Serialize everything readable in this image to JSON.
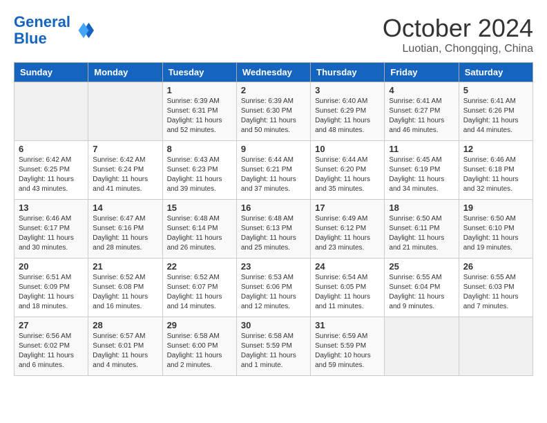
{
  "header": {
    "logo_line1": "General",
    "logo_line2": "Blue",
    "month_title": "October 2024",
    "location": "Luotian, Chongqing, China"
  },
  "weekdays": [
    "Sunday",
    "Monday",
    "Tuesday",
    "Wednesday",
    "Thursday",
    "Friday",
    "Saturday"
  ],
  "weeks": [
    [
      {
        "day": "",
        "empty": true
      },
      {
        "day": "",
        "empty": true
      },
      {
        "day": "1",
        "sunrise": "Sunrise: 6:39 AM",
        "sunset": "Sunset: 6:31 PM",
        "daylight": "Daylight: 11 hours and 52 minutes."
      },
      {
        "day": "2",
        "sunrise": "Sunrise: 6:39 AM",
        "sunset": "Sunset: 6:30 PM",
        "daylight": "Daylight: 11 hours and 50 minutes."
      },
      {
        "day": "3",
        "sunrise": "Sunrise: 6:40 AM",
        "sunset": "Sunset: 6:29 PM",
        "daylight": "Daylight: 11 hours and 48 minutes."
      },
      {
        "day": "4",
        "sunrise": "Sunrise: 6:41 AM",
        "sunset": "Sunset: 6:27 PM",
        "daylight": "Daylight: 11 hours and 46 minutes."
      },
      {
        "day": "5",
        "sunrise": "Sunrise: 6:41 AM",
        "sunset": "Sunset: 6:26 PM",
        "daylight": "Daylight: 11 hours and 44 minutes."
      }
    ],
    [
      {
        "day": "6",
        "sunrise": "Sunrise: 6:42 AM",
        "sunset": "Sunset: 6:25 PM",
        "daylight": "Daylight: 11 hours and 43 minutes."
      },
      {
        "day": "7",
        "sunrise": "Sunrise: 6:42 AM",
        "sunset": "Sunset: 6:24 PM",
        "daylight": "Daylight: 11 hours and 41 minutes."
      },
      {
        "day": "8",
        "sunrise": "Sunrise: 6:43 AM",
        "sunset": "Sunset: 6:23 PM",
        "daylight": "Daylight: 11 hours and 39 minutes."
      },
      {
        "day": "9",
        "sunrise": "Sunrise: 6:44 AM",
        "sunset": "Sunset: 6:21 PM",
        "daylight": "Daylight: 11 hours and 37 minutes."
      },
      {
        "day": "10",
        "sunrise": "Sunrise: 6:44 AM",
        "sunset": "Sunset: 6:20 PM",
        "daylight": "Daylight: 11 hours and 35 minutes."
      },
      {
        "day": "11",
        "sunrise": "Sunrise: 6:45 AM",
        "sunset": "Sunset: 6:19 PM",
        "daylight": "Daylight: 11 hours and 34 minutes."
      },
      {
        "day": "12",
        "sunrise": "Sunrise: 6:46 AM",
        "sunset": "Sunset: 6:18 PM",
        "daylight": "Daylight: 11 hours and 32 minutes."
      }
    ],
    [
      {
        "day": "13",
        "sunrise": "Sunrise: 6:46 AM",
        "sunset": "Sunset: 6:17 PM",
        "daylight": "Daylight: 11 hours and 30 minutes."
      },
      {
        "day": "14",
        "sunrise": "Sunrise: 6:47 AM",
        "sunset": "Sunset: 6:16 PM",
        "daylight": "Daylight: 11 hours and 28 minutes."
      },
      {
        "day": "15",
        "sunrise": "Sunrise: 6:48 AM",
        "sunset": "Sunset: 6:14 PM",
        "daylight": "Daylight: 11 hours and 26 minutes."
      },
      {
        "day": "16",
        "sunrise": "Sunrise: 6:48 AM",
        "sunset": "Sunset: 6:13 PM",
        "daylight": "Daylight: 11 hours and 25 minutes."
      },
      {
        "day": "17",
        "sunrise": "Sunrise: 6:49 AM",
        "sunset": "Sunset: 6:12 PM",
        "daylight": "Daylight: 11 hours and 23 minutes."
      },
      {
        "day": "18",
        "sunrise": "Sunrise: 6:50 AM",
        "sunset": "Sunset: 6:11 PM",
        "daylight": "Daylight: 11 hours and 21 minutes."
      },
      {
        "day": "19",
        "sunrise": "Sunrise: 6:50 AM",
        "sunset": "Sunset: 6:10 PM",
        "daylight": "Daylight: 11 hours and 19 minutes."
      }
    ],
    [
      {
        "day": "20",
        "sunrise": "Sunrise: 6:51 AM",
        "sunset": "Sunset: 6:09 PM",
        "daylight": "Daylight: 11 hours and 18 minutes."
      },
      {
        "day": "21",
        "sunrise": "Sunrise: 6:52 AM",
        "sunset": "Sunset: 6:08 PM",
        "daylight": "Daylight: 11 hours and 16 minutes."
      },
      {
        "day": "22",
        "sunrise": "Sunrise: 6:52 AM",
        "sunset": "Sunset: 6:07 PM",
        "daylight": "Daylight: 11 hours and 14 minutes."
      },
      {
        "day": "23",
        "sunrise": "Sunrise: 6:53 AM",
        "sunset": "Sunset: 6:06 PM",
        "daylight": "Daylight: 11 hours and 12 minutes."
      },
      {
        "day": "24",
        "sunrise": "Sunrise: 6:54 AM",
        "sunset": "Sunset: 6:05 PM",
        "daylight": "Daylight: 11 hours and 11 minutes."
      },
      {
        "day": "25",
        "sunrise": "Sunrise: 6:55 AM",
        "sunset": "Sunset: 6:04 PM",
        "daylight": "Daylight: 11 hours and 9 minutes."
      },
      {
        "day": "26",
        "sunrise": "Sunrise: 6:55 AM",
        "sunset": "Sunset: 6:03 PM",
        "daylight": "Daylight: 11 hours and 7 minutes."
      }
    ],
    [
      {
        "day": "27",
        "sunrise": "Sunrise: 6:56 AM",
        "sunset": "Sunset: 6:02 PM",
        "daylight": "Daylight: 11 hours and 6 minutes."
      },
      {
        "day": "28",
        "sunrise": "Sunrise: 6:57 AM",
        "sunset": "Sunset: 6:01 PM",
        "daylight": "Daylight: 11 hours and 4 minutes."
      },
      {
        "day": "29",
        "sunrise": "Sunrise: 6:58 AM",
        "sunset": "Sunset: 6:00 PM",
        "daylight": "Daylight: 11 hours and 2 minutes."
      },
      {
        "day": "30",
        "sunrise": "Sunrise: 6:58 AM",
        "sunset": "Sunset: 5:59 PM",
        "daylight": "Daylight: 11 hours and 1 minute."
      },
      {
        "day": "31",
        "sunrise": "Sunrise: 6:59 AM",
        "sunset": "Sunset: 5:59 PM",
        "daylight": "Daylight: 10 hours and 59 minutes."
      },
      {
        "day": "",
        "empty": true
      },
      {
        "day": "",
        "empty": true
      }
    ]
  ]
}
